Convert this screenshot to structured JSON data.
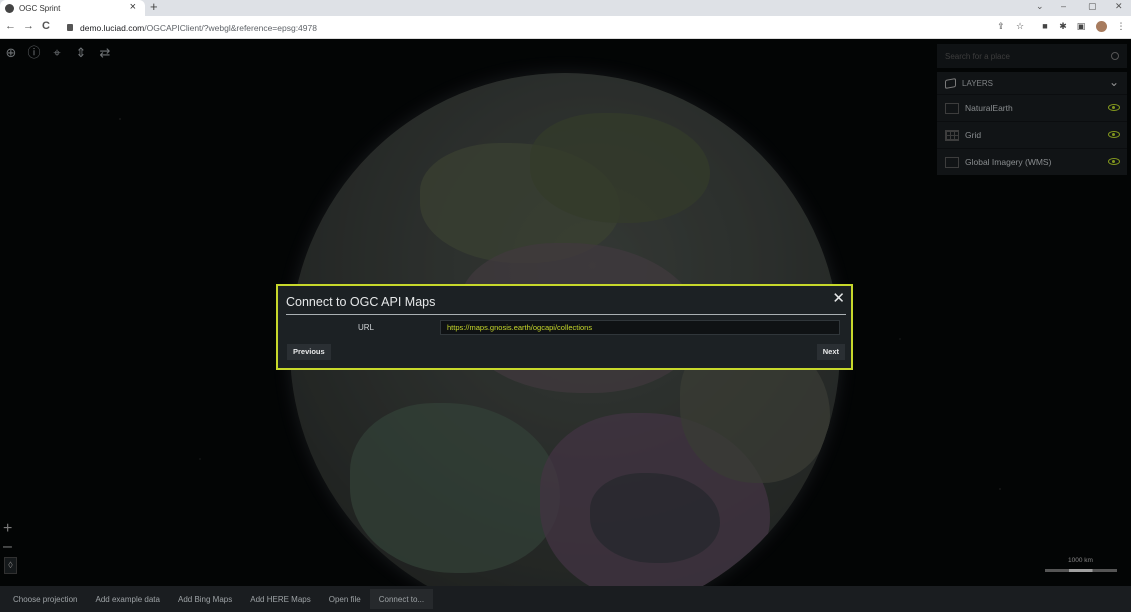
{
  "browser": {
    "tab_title": "OGC Sprint",
    "tab_close": "×",
    "new_tab": "+",
    "url_host": "demo.luciad.com",
    "url_path": "/OGCAPIClient/?webgl&reference=epsg:4978",
    "back": "←",
    "forward": "→",
    "reload": "C"
  },
  "toolbar_icons": [
    "globe-icon",
    "info-icon",
    "fit-icon",
    "vertical-move-icon",
    "swap-icon"
  ],
  "search": {
    "placeholder": "Search for a place"
  },
  "layers": {
    "header": "LAYERS",
    "items": [
      {
        "label": "NaturalEarth",
        "visible": true
      },
      {
        "label": "Grid",
        "visible": true
      },
      {
        "label": "Global Imagery (WMS)",
        "visible": true
      }
    ]
  },
  "scale": {
    "label": "1000 km"
  },
  "bottom_toolbar": {
    "items": [
      "Choose projection",
      "Add example data",
      "Add Bing Maps",
      "Add HERE Maps",
      "Open file",
      "Connect to..."
    ]
  },
  "dialog": {
    "title": "Connect to OGC API Maps",
    "close": "✕",
    "url_label": "URL",
    "url_value": "https://maps.gnosis.earth/ogcapi/collections",
    "previous": "Previous",
    "next": "Next",
    "accent_color": "#c7d82b"
  }
}
